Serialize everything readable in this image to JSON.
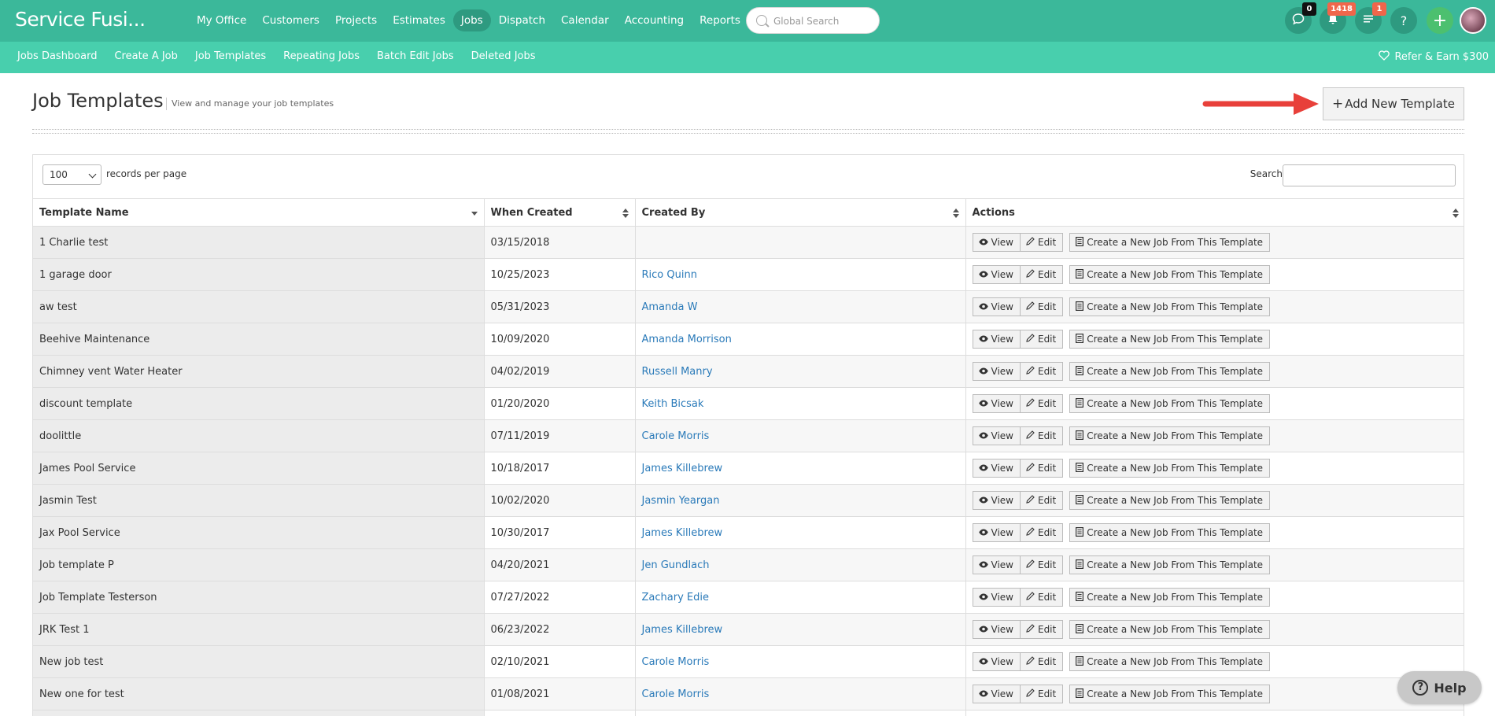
{
  "header": {
    "brand": "Service Fusi...",
    "nav": [
      {
        "label": "My Office"
      },
      {
        "label": "Customers"
      },
      {
        "label": "Projects"
      },
      {
        "label": "Estimates"
      },
      {
        "label": "Jobs",
        "active": true
      },
      {
        "label": "Dispatch"
      },
      {
        "label": "Calendar"
      },
      {
        "label": "Accounting"
      },
      {
        "label": "Reports"
      }
    ],
    "search_placeholder": "Global Search",
    "chat_count": "0",
    "notification_count": "1418",
    "tasks_count": "1",
    "help_glyph": "?",
    "add_glyph": "+"
  },
  "subnav": {
    "items": [
      "Jobs Dashboard",
      "Create A Job",
      "Job Templates",
      "Repeating Jobs",
      "Batch Edit Jobs",
      "Deleted Jobs"
    ],
    "refer": "Refer & Earn $300"
  },
  "page": {
    "title": "Job Templates",
    "subtitle": "View and manage your job templates",
    "add_button": "Add New Template"
  },
  "table_controls": {
    "per_page_value": "100",
    "per_page_label": "records per page",
    "search_label": "Search:"
  },
  "table": {
    "columns": [
      "Template Name",
      "When Created",
      "Created By",
      "Actions"
    ],
    "action_labels": {
      "view": "View",
      "edit": "Edit",
      "create": "Create a New Job From This Template"
    },
    "rows": [
      {
        "name": "1 Charlie test",
        "created": "03/15/2018",
        "by": ""
      },
      {
        "name": "1 garage door",
        "created": "10/25/2023",
        "by": "Rico Quinn"
      },
      {
        "name": "aw test",
        "created": "05/31/2023",
        "by": "Amanda W"
      },
      {
        "name": "Beehive Maintenance",
        "created": "10/09/2020",
        "by": "Amanda Morrison"
      },
      {
        "name": "Chimney vent Water Heater",
        "created": "04/02/2019",
        "by": "Russell Manry"
      },
      {
        "name": "discount template",
        "created": "01/20/2020",
        "by": "Keith Bicsak"
      },
      {
        "name": "doolittle",
        "created": "07/11/2019",
        "by": "Carole Morris"
      },
      {
        "name": "James Pool Service",
        "created": "10/18/2017",
        "by": "James Killebrew"
      },
      {
        "name": "Jasmin Test",
        "created": "10/02/2020",
        "by": "Jasmin Yeargan"
      },
      {
        "name": "Jax Pool Service",
        "created": "10/30/2017",
        "by": "James Killebrew"
      },
      {
        "name": "Job template P",
        "created": "04/20/2021",
        "by": "Jen Gundlach"
      },
      {
        "name": "Job Template Testerson",
        "created": "07/27/2022",
        "by": "Zachary Edie"
      },
      {
        "name": "JRK Test 1",
        "created": "06/23/2022",
        "by": "James Killebrew"
      },
      {
        "name": "New job test",
        "created": "02/10/2021",
        "by": "Carole Morris"
      },
      {
        "name": "New one for test",
        "created": "01/08/2021",
        "by": "Carole Morris"
      },
      {
        "name": "",
        "created": "",
        "by": ""
      }
    ]
  },
  "help_widget": {
    "label": "Help"
  },
  "colors": {
    "topbar": "#3bb89a",
    "subbar": "#48cfad",
    "link": "#2a7ab9",
    "arrow": "#e8403a"
  }
}
